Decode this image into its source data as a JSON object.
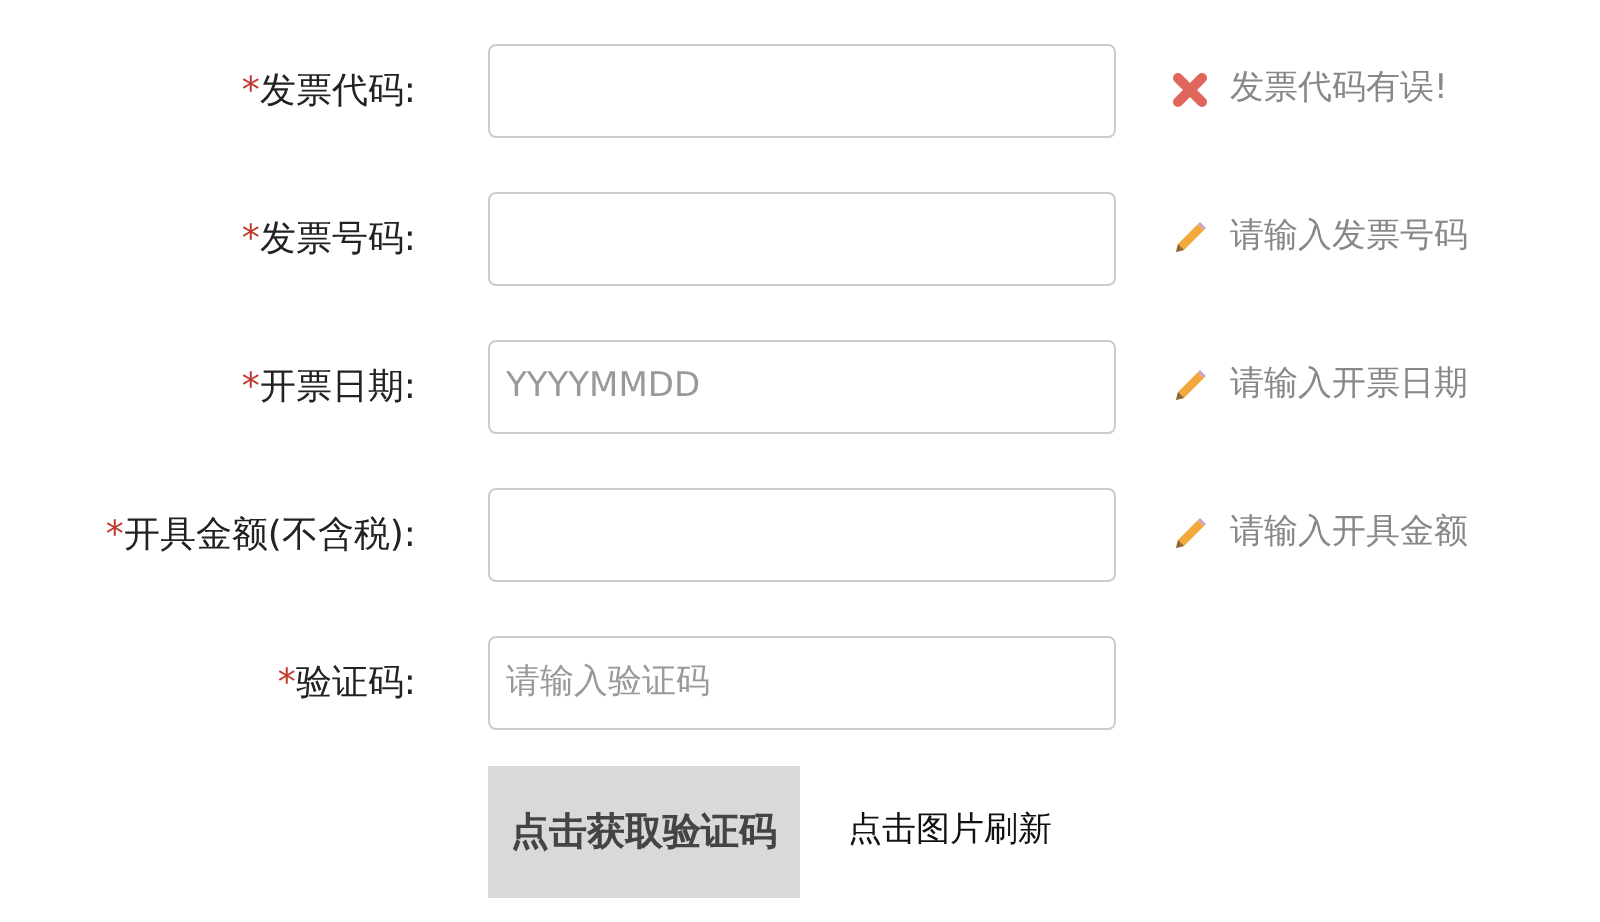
{
  "fields": [
    {
      "label": "发票代码:",
      "required_mark": "*",
      "hint": {
        "kind": "error",
        "text": "发票代码有误!"
      }
    },
    {
      "label": "发票号码:",
      "required_mark": "*",
      "hint": {
        "kind": "info",
        "text": "请输入发票号码"
      }
    },
    {
      "label": "开票日期:",
      "required_mark": "*",
      "placeholder": "YYYYMMDD",
      "hint": {
        "kind": "info",
        "text": "请输入开票日期"
      }
    },
    {
      "label": "开具金额(不含税):",
      "required_mark": "*",
      "hint": {
        "kind": "info",
        "text": "请输入开具金额"
      }
    },
    {
      "label": "验证码:",
      "required_mark": "*",
      "placeholder": "请输入验证码"
    }
  ],
  "captcha": {
    "image_text": "点击获取验证码",
    "refresh_text": "点击图片刷新"
  }
}
